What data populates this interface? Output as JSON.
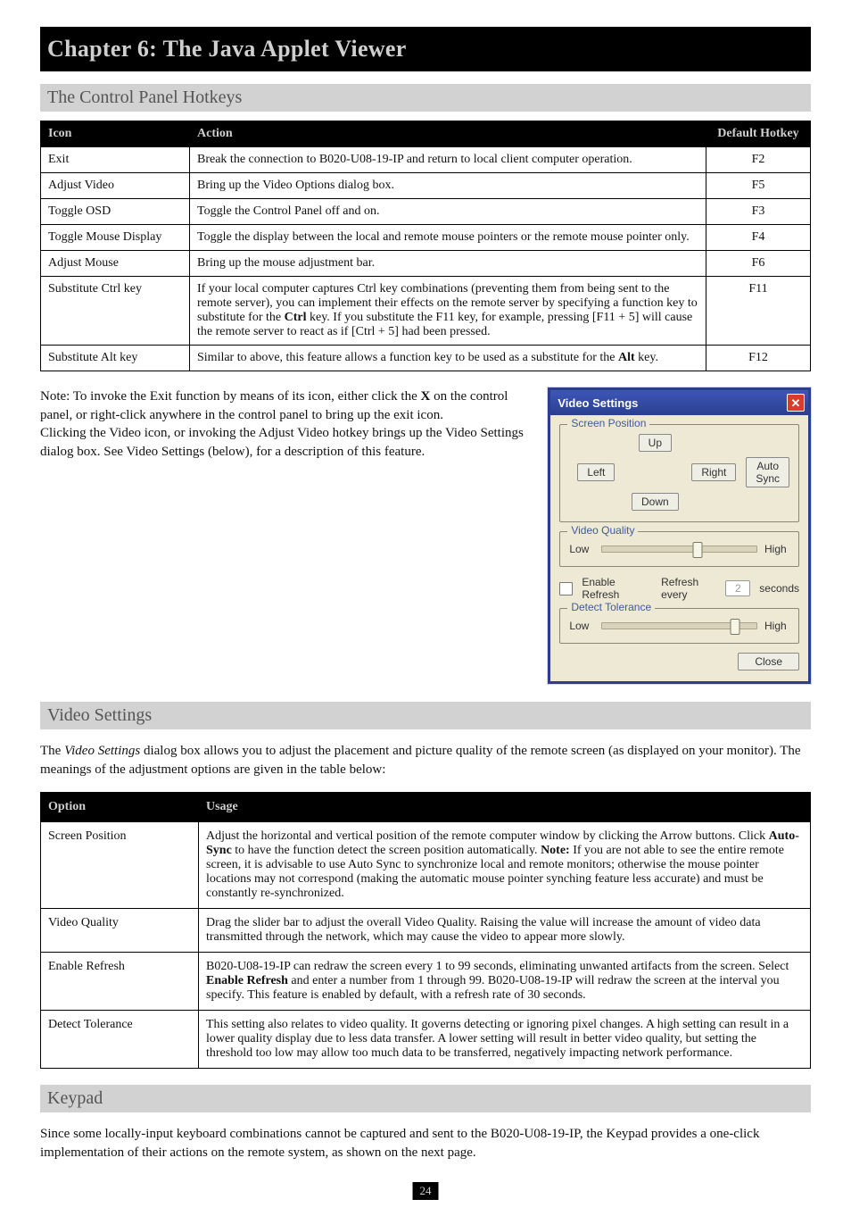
{
  "chapter_title": "Chapter 6: The Java Applet Viewer",
  "section1": {
    "heading": "The Control Panel Hotkeys",
    "table": {
      "headers": [
        "Icon",
        "Action",
        "Default Hotkey"
      ],
      "rows": [
        {
          "c1": "Exit",
          "c2": "Break the connection to B020-U08-19-IP and return to local client computer operation.",
          "c3": "F2"
        },
        {
          "c1": "Adjust Video",
          "c2": "Bring up the Video Options dialog box.",
          "c3": "F5"
        },
        {
          "c1": "Toggle OSD",
          "c2": "Toggle the Control Panel off and on.",
          "c3": "F3"
        },
        {
          "c1": "Toggle Mouse Display",
          "c2": "Toggle the display between the local and remote mouse pointers or the remote mouse pointer only.",
          "c3": "F4"
        },
        {
          "c1": "Adjust Mouse",
          "c2": "Bring up the mouse adjustment bar.",
          "c3": "F6"
        },
        {
          "c1": "Substitute Ctrl key",
          "c2_pre": "If your local computer captures Ctrl key combinations (preventing them from being sent to the remote server), you can implement their effects on the remote server by specifying a function key to substitute for the ",
          "c2_bold": "Ctrl",
          "c2_post": " key. If you substitute the F11 key, for example, pressing [F11 + 5] will cause the remote server to react as if [Ctrl + 5] had been pressed.",
          "c3": "F11"
        },
        {
          "c1": "Substitute Alt key",
          "c2_pre": "Similar to above, this feature allows a function key to be used as a substitute for the ",
          "c2_bold": "Alt",
          "c2_post": " key.",
          "c3": "F12"
        }
      ]
    }
  },
  "after_table_note": {
    "pre": "Note: To invoke the Exit function by means of its icon, either click the ",
    "bold": "X",
    "rest": " on the control panel, or right-click anywhere in the control panel to bring up the exit icon.\nClicking the Video icon, or invoking the Adjust Video hotkey brings up the Video Settings dialog box. See Video Settings (below), for a description of this feature."
  },
  "vs_window": {
    "title": "Video Settings",
    "groups": {
      "screen_position": "Screen Position",
      "video_quality": "Video Quality",
      "detect_tolerance": "Detect Tolerance"
    },
    "buttons": {
      "up": "Up",
      "down": "Down",
      "left": "Left",
      "right": "Right",
      "auto_sync": "Auto Sync",
      "close": "Close"
    },
    "labels": {
      "low": "Low",
      "high": "High",
      "enable_refresh": "Enable Refresh",
      "refresh_every": "Refresh every",
      "seconds": "seconds"
    },
    "refresh_seconds": "2"
  },
  "section2": {
    "heading": "Video Settings",
    "text": {
      "pre": "The ",
      "italic": "Video Settings",
      "post": " dialog box allows you to adjust the placement and picture quality of the remote screen (as displayed on your monitor). The meanings of the adjustment options are given in the table below:"
    },
    "table": {
      "headers": [
        "Option",
        "Usage"
      ],
      "rows": [
        {
          "c1": "Screen Position",
          "c2_pre": "Adjust the horizontal and vertical position of the remote computer window by clicking the Arrow buttons. Click ",
          "c2_bold": "Auto-Sync",
          "c2_mid": " to have the function detect the screen position automatically. ",
          "c2_note_head": "Note:",
          "c2_note_body": " If you are not able to see the entire remote screen, it is advisable to use Auto Sync to synchronize local and remote monitors; otherwise the mouse pointer locations may not correspond (making the automatic mouse pointer synching feature less accurate) and must be constantly re-synchronized."
        },
        {
          "c1": "Video Quality",
          "c2": "Drag the slider bar to adjust the overall Video Quality. Raising the value will increase the amount of video data transmitted through the network, which may cause the video to appear more slowly."
        },
        {
          "c1": "Enable Refresh",
          "c2_pre": "B020-U08-19-IP can redraw the screen every 1 to 99 seconds, eliminating unwanted artifacts from the screen. Select ",
          "c2_bold": "Enable Refresh",
          "c2_post": " and enter a number from 1 through 99. B020-U08-19-IP will redraw the screen at the interval you specify. This feature is enabled by default, with a refresh rate of 30 seconds."
        },
        {
          "c1": "Detect Tolerance",
          "c2": "This setting also relates to video quality. It governs detecting or ignoring pixel changes. A high setting can result in a lower quality display due to less data transfer. A lower setting will result in better video quality, but setting the threshold too low may allow too much data to be transferred, negatively impacting network performance."
        }
      ]
    }
  },
  "section3_heading": "Keypad",
  "section3_body": "Since some locally-input keyboard combinations cannot be captured and sent to the B020-U08-19-IP, the Keypad provides a one-click implementation of their actions on the remote system, as shown on the next page.",
  "page_number": "24"
}
